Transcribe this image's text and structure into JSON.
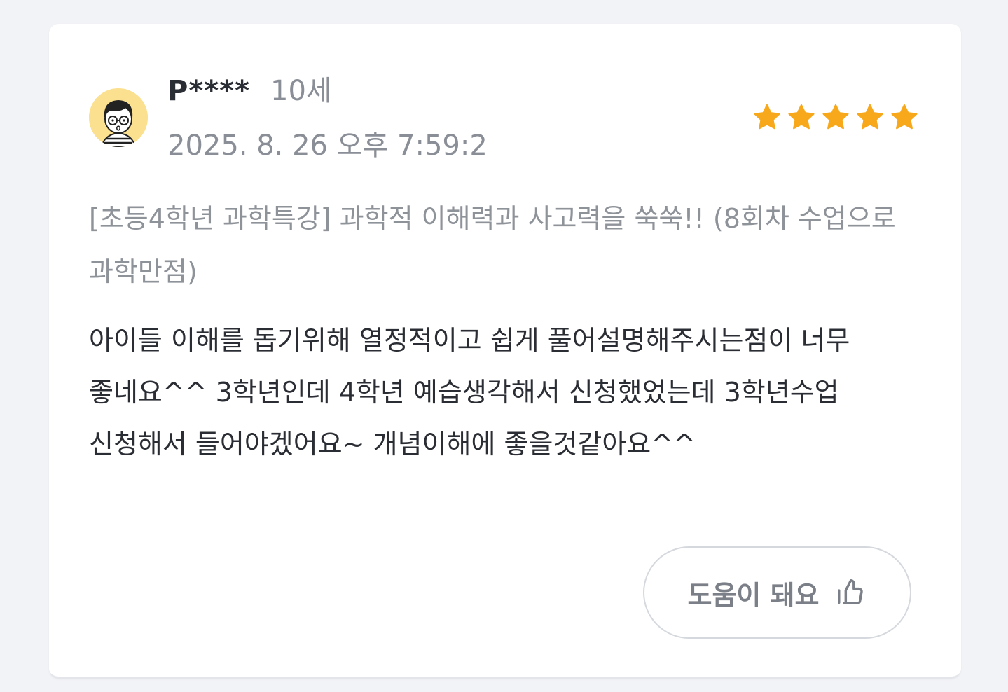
{
  "review": {
    "username": "P****",
    "age": "10세",
    "date": "2025. 8. 26 오후 7:59:2",
    "rating": 5,
    "rating_max": 5,
    "course_title": "[초등4학년 과학특강] 과학적 이해력과 사고력을 쑥쑥!! (8회차 수업으로 과학만점)",
    "content": "아이들 이해를 돕기위해 열정적이고 쉽게 풀어설명해주시는점이 너무 좋네요^^ 3학년인데 4학년 예습생각해서 신청했었는데 3학년수업 신청해서 들어야겠어요~ 개념이해에 좋을것같아요^^",
    "helpful_label": "도움이 돼요",
    "avatar_icon": "boy-with-glasses-avatar",
    "star_icon": "star-icon",
    "helpful_icon": "thumbs-up-icon"
  },
  "colors": {
    "star": "#f7a81b",
    "avatar_bg": "#fbe08f",
    "text_primary": "#2a2d33",
    "text_secondary": "#8a8e96",
    "page_bg": "#f2f3f6"
  }
}
